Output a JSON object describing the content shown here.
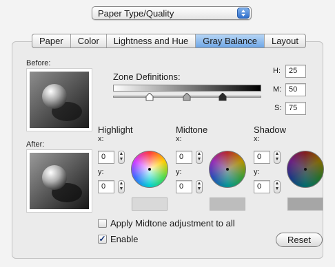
{
  "popup": {
    "value": "Paper Type/Quality"
  },
  "tabs": [
    {
      "label": "Paper"
    },
    {
      "label": "Color"
    },
    {
      "label": "Lightness and Hue"
    },
    {
      "label": "Gray Balance",
      "active": true
    },
    {
      "label": "Layout"
    }
  ],
  "before_label": "Before:",
  "after_label": "After:",
  "zone": {
    "label": "Zone Definitions:"
  },
  "hms": [
    {
      "label": "H:",
      "value": "25"
    },
    {
      "label": "M:",
      "value": "50"
    },
    {
      "label": "S:",
      "value": "75"
    }
  ],
  "zones": [
    {
      "title": "Highlight",
      "x_label": "x:",
      "x_value": "0",
      "y_label": "y:",
      "y_value": "0",
      "swatch": "#d9d9d9",
      "wheel_shade": 0.0
    },
    {
      "title": "Midtone",
      "x_label": "x:",
      "x_value": "0",
      "y_label": "y:",
      "y_value": "0",
      "swatch": "#bdbdbd",
      "wheel_shade": 0.35
    },
    {
      "title": "Shadow",
      "x_label": "x:",
      "x_value": "0",
      "y_label": "y:",
      "y_value": "0",
      "swatch": "#a6a6a6",
      "wheel_shade": 0.6
    }
  ],
  "apply_midtone": {
    "label": "Apply Midtone adjustment to all",
    "checked": false
  },
  "enable": {
    "label": "Enable",
    "checked": true
  },
  "reset": {
    "label": "Reset"
  }
}
